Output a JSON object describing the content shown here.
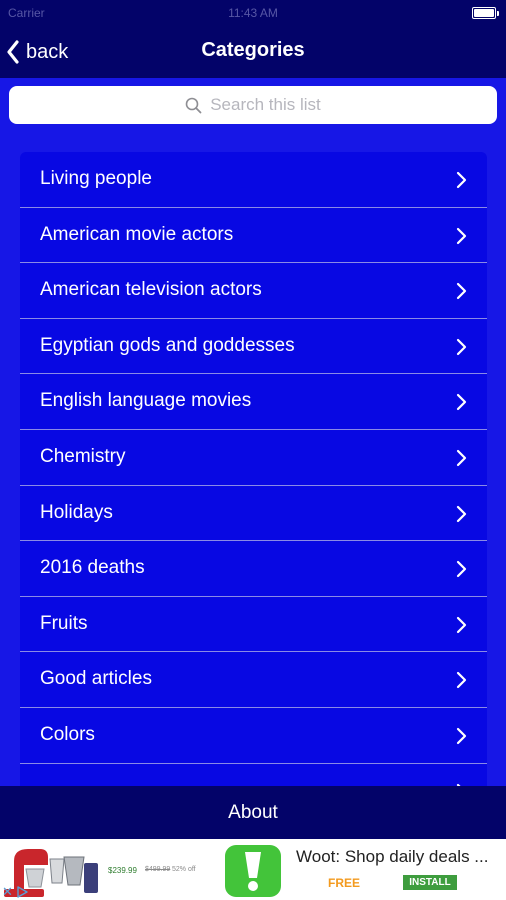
{
  "status_bar": {
    "carrier": "Carrier",
    "time": "11:43 AM"
  },
  "nav": {
    "back_label": "back",
    "title": "Categories"
  },
  "search": {
    "placeholder": "Search this list"
  },
  "categories": [
    {
      "label": "Living people"
    },
    {
      "label": "American movie actors"
    },
    {
      "label": "American television actors"
    },
    {
      "label": "Egyptian gods and goddesses"
    },
    {
      "label": "English language movies"
    },
    {
      "label": "Chemistry"
    },
    {
      "label": "Holidays"
    },
    {
      "label": "2016 deaths"
    },
    {
      "label": "Fruits"
    },
    {
      "label": "Good articles"
    },
    {
      "label": "Colors"
    },
    {
      "label": ""
    }
  ],
  "bottom": {
    "about_label": "About"
  },
  "ad": {
    "price": "$239.99",
    "old_price": "$499.99",
    "save_text": "52% off",
    "text": "Woot: Shop daily deals ...",
    "free_label": "FREE",
    "install_label": "INSTALL",
    "app_icon": "exclamation-icon"
  },
  "colors": {
    "bar_background": "#030369",
    "page_background": "#1717e6",
    "list_item_background": "#0808e3",
    "separator": "#8a8ae6",
    "ad_icon_green": "#43c43a",
    "free_orange": "#f39a1e"
  }
}
